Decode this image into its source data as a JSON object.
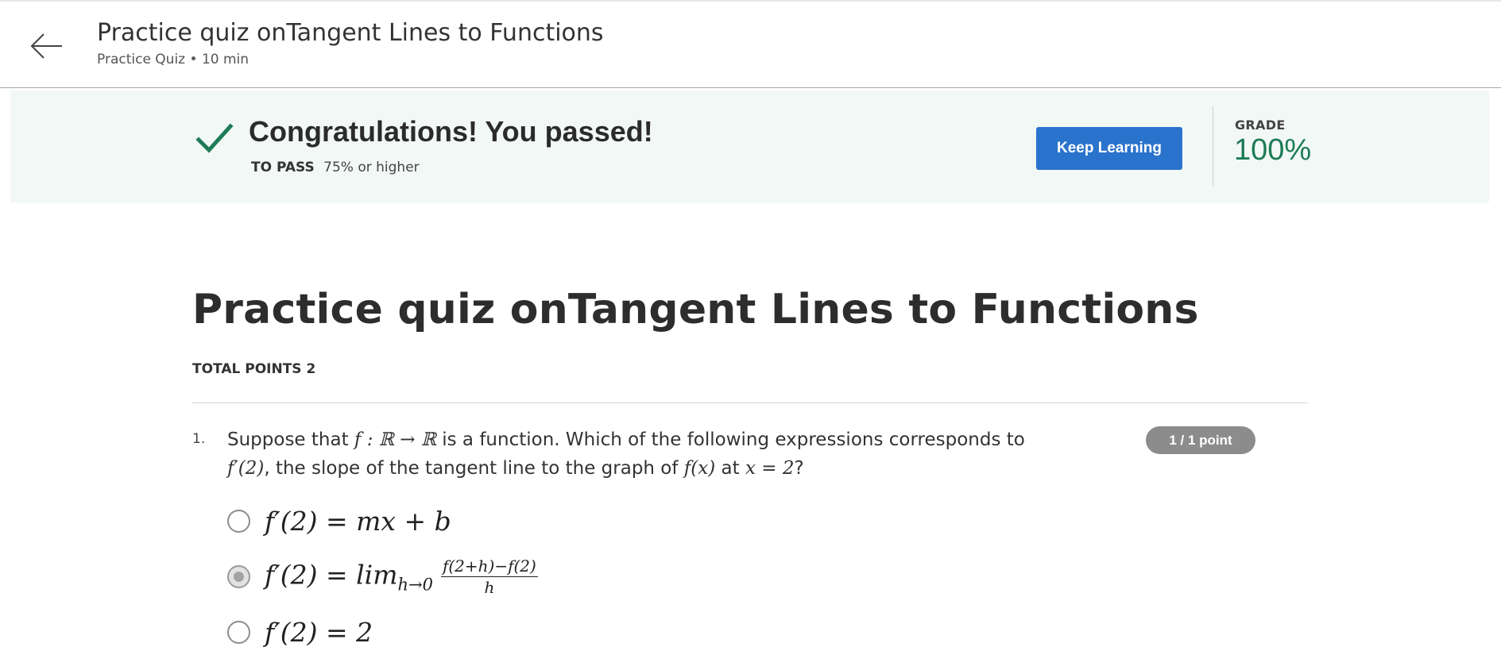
{
  "header": {
    "title": "Practice quiz onTangent Lines to Functions",
    "subtitle": "Practice Quiz • 10 min"
  },
  "banner": {
    "message": "Congratulations! You passed!",
    "to_pass_label": "TO PASS",
    "to_pass_value": "75% or higher",
    "keep_learning_label": "Keep Learning",
    "grade_label": "GRADE",
    "grade_value": "100%"
  },
  "quiz": {
    "title": "Practice quiz onTangent Lines to Functions",
    "total_points": "TOTAL POINTS 2",
    "questions": [
      {
        "number": "1.",
        "text_line1_a": "Suppose that ",
        "text_line1_math": "f : ℝ → ℝ",
        "text_line1_b": " is a function. Which of the following expressions corresponds to",
        "text_line2_math1": "f′(2)",
        "text_line2_a": ", the slope of the tangent line to the graph of ",
        "text_line2_math2": "f(x)",
        "text_line2_b": " at ",
        "text_line2_math3": "x = 2",
        "text_line2_c": "?",
        "points": "1 / 1 point",
        "options": [
          {
            "text": "f′(2) = mx + b",
            "selected": false
          },
          {
            "lhs": "f′(2) = lim",
            "sub": "h→0",
            "num": "f(2+h)−f(2)",
            "den": "h",
            "selected": true
          },
          {
            "text": "f′(2) = 2",
            "selected": false
          }
        ]
      }
    ]
  },
  "colors": {
    "banner_bg": "#f2f8f6",
    "success_green": "#1d7b56",
    "button_blue": "#2a73cc",
    "badge_gray": "#8c8c8c"
  },
  "icons": {
    "back": "arrow-left-icon",
    "pass": "check-icon"
  }
}
